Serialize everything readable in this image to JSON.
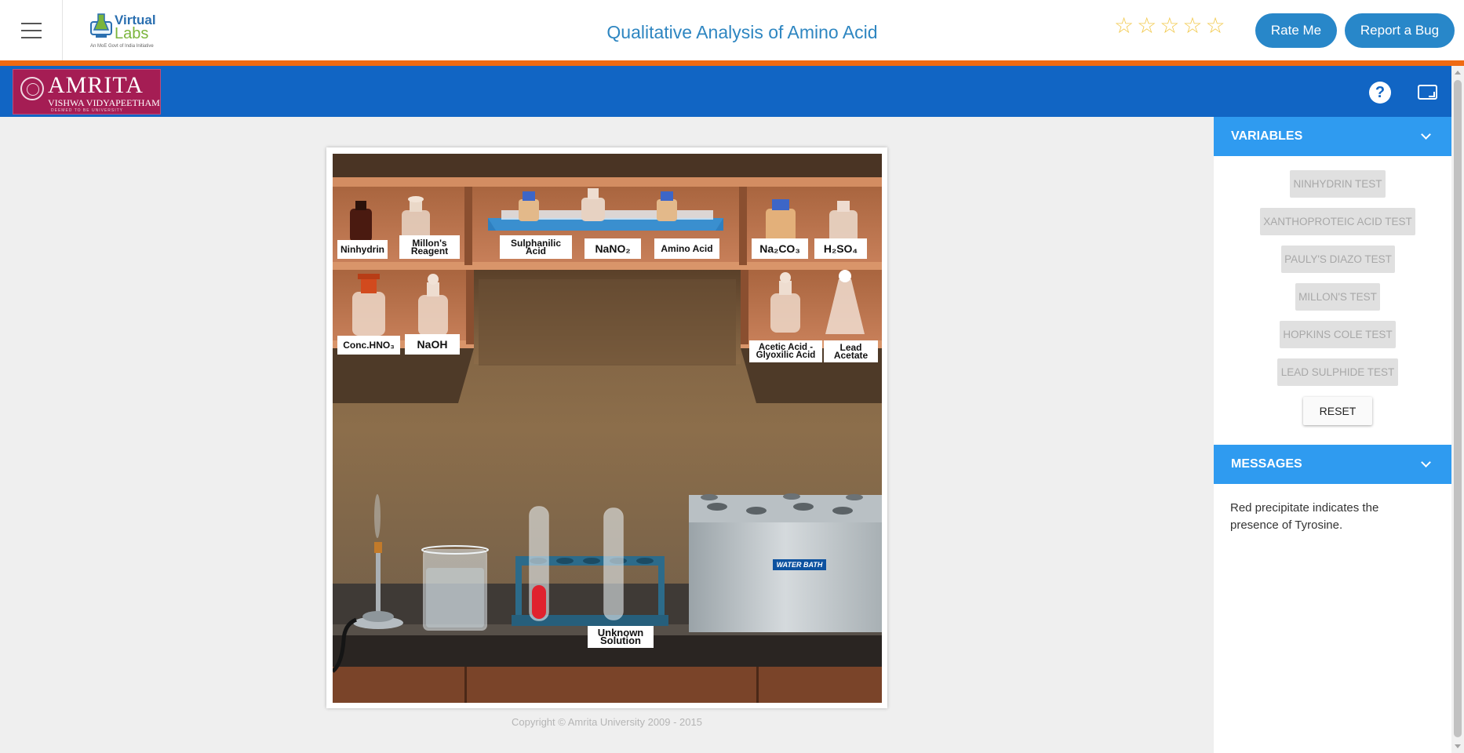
{
  "header": {
    "title": "Qualitative Analysis of Amino Acid",
    "logo": {
      "word1": "Virtual",
      "word2": "Labs",
      "tagline": "An MoE Govt of India Initiative"
    },
    "rating": {
      "stars": 5,
      "filled": 0
    },
    "rate_label": "Rate Me",
    "bug_label": "Report a Bug",
    "accent_color": "#ef6a12"
  },
  "nav": {
    "brand": {
      "name": "AMRITA",
      "sub": "VISHWA VIDYAPEETHAM",
      "tiny": "DEEMED TO BE UNIVERSITY"
    },
    "help_icon": "?",
    "fullscreen_icon": "fullscreen-icon",
    "bar_color": "#1165c4"
  },
  "lab": {
    "shelf_labels": {
      "ninhydrin": "Ninhydrin",
      "millons": "Millon's Reagent",
      "sulphanilic": "Sulphanilic Acid",
      "nano2": "NaNO₂",
      "amino": "Amino Acid",
      "na2co3": "Na₂CO₃",
      "h2so4": "H₂SO₄",
      "hno3": "Conc.HNO₃",
      "naoh": "NaOH",
      "acetic": "Acetic Acid - Glyoxilic Acid",
      "lead": "Lead Acetate"
    },
    "unknown_label": "Unknown Solution",
    "water_bath_label": "WATER BATH"
  },
  "copyright": "Copyright © Amrita University 2009 - 2015",
  "panel": {
    "variables_title": "VARIABLES",
    "tests": [
      "NINHYDRIN TEST",
      "XANTHOPROTEIC ACID TEST",
      "PAULY'S DIAZO TEST",
      "MILLON'S TEST",
      "HOPKINS COLE TEST",
      "LEAD SULPHIDE TEST"
    ],
    "reset_label": "RESET",
    "messages_title": "MESSAGES",
    "message_text": "Red precipitate indicates the presence of Tyrosine.",
    "header_color": "#2f9bf0"
  }
}
